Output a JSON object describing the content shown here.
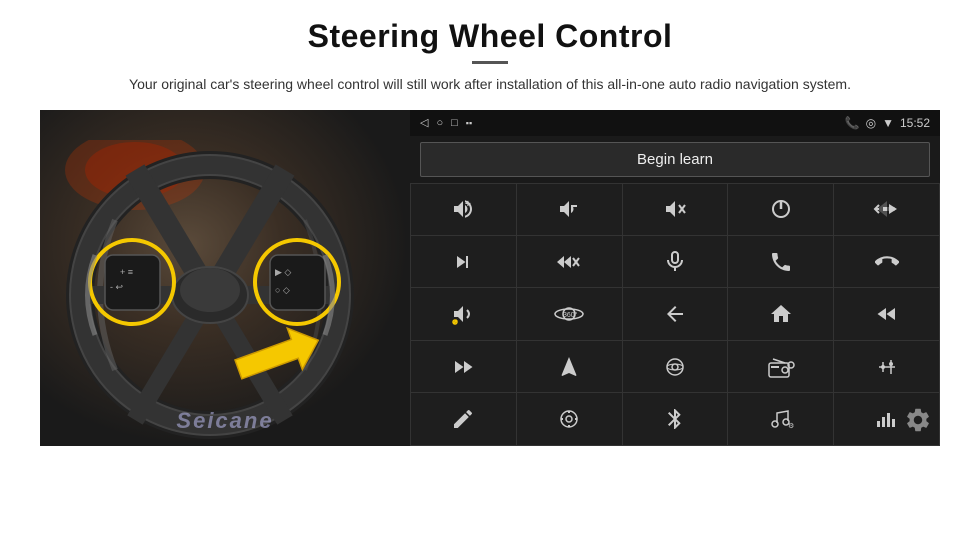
{
  "header": {
    "title": "Steering Wheel Control",
    "divider": true,
    "subtitle": "Your original car's steering wheel control will still work after installation of this all-in-one auto radio navigation system."
  },
  "status_bar": {
    "left_icons": [
      "◁",
      "○",
      "□",
      "▪▪"
    ],
    "right_icons": [
      "📞",
      "◎",
      "▼"
    ],
    "time": "15:52"
  },
  "begin_learn": {
    "label": "Begin learn"
  },
  "controls": [
    {
      "icon": "🔊+",
      "label": "vol-up"
    },
    {
      "icon": "🔊-",
      "label": "vol-down"
    },
    {
      "icon": "🔇",
      "label": "mute"
    },
    {
      "icon": "⏻",
      "label": "power"
    },
    {
      "icon": "⏮",
      "label": "prev-track"
    },
    {
      "icon": "⏭",
      "label": "next"
    },
    {
      "icon": "⏩",
      "label": "ff"
    },
    {
      "icon": "🎤",
      "label": "mic"
    },
    {
      "icon": "📞",
      "label": "call"
    },
    {
      "icon": "↩",
      "label": "hang-up"
    },
    {
      "icon": "📢",
      "label": "horn"
    },
    {
      "icon": "360°",
      "label": "360-cam"
    },
    {
      "icon": "↩",
      "label": "back"
    },
    {
      "icon": "⌂",
      "label": "home"
    },
    {
      "icon": "⏮⏮",
      "label": "rew"
    },
    {
      "icon": "⏭⏭",
      "label": "skip"
    },
    {
      "icon": "▶",
      "label": "nav"
    },
    {
      "icon": "⏏",
      "label": "eject"
    },
    {
      "icon": "📻",
      "label": "radio"
    },
    {
      "icon": "≡↕",
      "label": "eq"
    },
    {
      "icon": "✏",
      "label": "edit"
    },
    {
      "icon": "⚙",
      "label": "settings2"
    },
    {
      "icon": "✱",
      "label": "bluetooth"
    },
    {
      "icon": "🎵",
      "label": "music"
    },
    {
      "icon": "▌▌▌",
      "label": "spectrum"
    }
  ],
  "watermark": "Seicane",
  "gear_icon": "⚙"
}
